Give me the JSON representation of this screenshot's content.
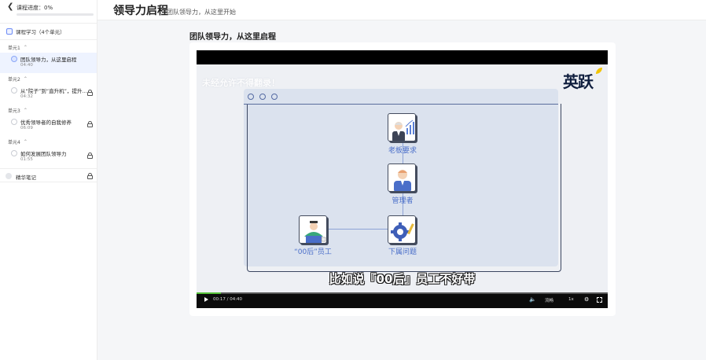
{
  "sidebar": {
    "back_icon": "chevron-left-icon",
    "progress_label": "课程进度：0%",
    "progress_fraction": 0,
    "course_heading": "课程学习（4个单元）",
    "units": [
      {
        "label": "单元1",
        "lesson": {
          "title": "团队领导力，从这里启程",
          "duration": "04:40",
          "locked": false,
          "active": true
        }
      },
      {
        "label": "单元2",
        "lesson": {
          "title": "从“院子”到“直升机”，提升...",
          "duration": "04:32",
          "locked": true,
          "active": false
        }
      },
      {
        "label": "单元3",
        "lesson": {
          "title": "优秀领导者的自我修养",
          "duration": "06:09",
          "locked": true,
          "active": false
        }
      },
      {
        "label": "单元4",
        "lesson": {
          "title": "如何发展团队领导力",
          "duration": "01:55",
          "locked": true,
          "active": false
        }
      }
    ],
    "notes_label": "精华笔记"
  },
  "header": {
    "title": "领导力启程",
    "subtitle": "团队领导力，从这里开始"
  },
  "content": {
    "section_title": "团队领导力，从这里启程"
  },
  "video": {
    "watermark": "未经允许不得翻录！",
    "brand_logo": "英跃",
    "nodes": {
      "boss": "老板要求",
      "manager": "管理者",
      "employee": "“00后”员工",
      "problem": "下属问题"
    },
    "caption": "比如说『00后』员工不好带",
    "controls": {
      "time": "00:17 / 04:40",
      "quality": "流畅",
      "speed": "1x",
      "progress_fraction": 0.06
    }
  },
  "colors": {
    "accent": "#3a6ff7",
    "seek_fill": "#56c23a",
    "diagram_label": "#4a6ec9"
  }
}
